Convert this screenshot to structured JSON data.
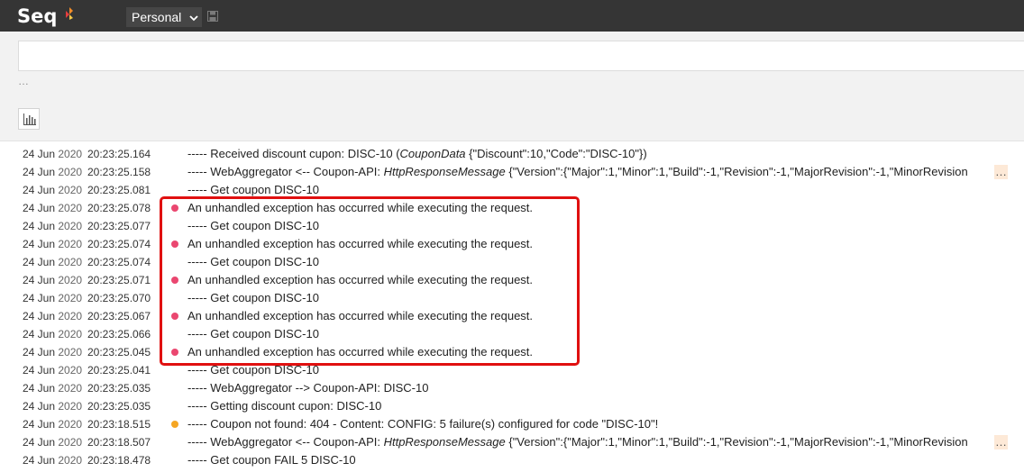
{
  "app": {
    "logo_text": "Seq",
    "workspace_label": "Personal"
  },
  "search": {
    "value": "",
    "placeholder": ""
  },
  "signal_hint": "…",
  "colors": {
    "error": "#ea4770",
    "warning": "#f5a623",
    "topbar": "#353535",
    "annotation": "#e01010"
  },
  "icons": {
    "workspace_dropdown": "chevron-down-icon",
    "save": "save-icon",
    "chart": "bar-chart-icon"
  },
  "events": [
    {
      "date": "24 Jun",
      "year": "2020",
      "time": "20:23:25.164",
      "level": "info",
      "prefix": "----- Received discount cupon: DISC-10 (",
      "type": "CouponData",
      "suffix": " {\"Discount\":10,\"Code\":\"DISC-10\"})",
      "truncated": false
    },
    {
      "date": "24 Jun",
      "year": "2020",
      "time": "20:23:25.158",
      "level": "info",
      "prefix": "----- WebAggregator <-- Coupon-API: ",
      "type": "HttpResponseMessage",
      "suffix": " {\"Version\":{\"Major\":1,\"Minor\":1,\"Build\":-1,\"Revision\":-1,\"MajorRevision\":-1,\"MinorRevision",
      "truncated": true
    },
    {
      "date": "24 Jun",
      "year": "2020",
      "time": "20:23:25.081",
      "level": "info",
      "prefix": "----- Get coupon DISC-10",
      "type": "",
      "suffix": "",
      "truncated": false
    },
    {
      "date": "24 Jun",
      "year": "2020",
      "time": "20:23:25.078",
      "level": "error",
      "prefix": "An unhandled exception has occurred while executing the request.",
      "type": "",
      "suffix": "",
      "truncated": false
    },
    {
      "date": "24 Jun",
      "year": "2020",
      "time": "20:23:25.077",
      "level": "info",
      "prefix": "----- Get coupon DISC-10",
      "type": "",
      "suffix": "",
      "truncated": false
    },
    {
      "date": "24 Jun",
      "year": "2020",
      "time": "20:23:25.074",
      "level": "error",
      "prefix": "An unhandled exception has occurred while executing the request.",
      "type": "",
      "suffix": "",
      "truncated": false
    },
    {
      "date": "24 Jun",
      "year": "2020",
      "time": "20:23:25.074",
      "level": "info",
      "prefix": "----- Get coupon DISC-10",
      "type": "",
      "suffix": "",
      "truncated": false
    },
    {
      "date": "24 Jun",
      "year": "2020",
      "time": "20:23:25.071",
      "level": "error",
      "prefix": "An unhandled exception has occurred while executing the request.",
      "type": "",
      "suffix": "",
      "truncated": false
    },
    {
      "date": "24 Jun",
      "year": "2020",
      "time": "20:23:25.070",
      "level": "info",
      "prefix": "----- Get coupon DISC-10",
      "type": "",
      "suffix": "",
      "truncated": false
    },
    {
      "date": "24 Jun",
      "year": "2020",
      "time": "20:23:25.067",
      "level": "error",
      "prefix": "An unhandled exception has occurred while executing the request.",
      "type": "",
      "suffix": "",
      "truncated": false
    },
    {
      "date": "24 Jun",
      "year": "2020",
      "time": "20:23:25.066",
      "level": "info",
      "prefix": "----- Get coupon DISC-10",
      "type": "",
      "suffix": "",
      "truncated": false
    },
    {
      "date": "24 Jun",
      "year": "2020",
      "time": "20:23:25.045",
      "level": "error",
      "prefix": "An unhandled exception has occurred while executing the request.",
      "type": "",
      "suffix": "",
      "truncated": false
    },
    {
      "date": "24 Jun",
      "year": "2020",
      "time": "20:23:25.041",
      "level": "info",
      "prefix": "----- Get coupon DISC-10",
      "type": "",
      "suffix": "",
      "truncated": false
    },
    {
      "date": "24 Jun",
      "year": "2020",
      "time": "20:23:25.035",
      "level": "info",
      "prefix": "----- WebAggregator --> Coupon-API: DISC-10",
      "type": "",
      "suffix": "",
      "truncated": false
    },
    {
      "date": "24 Jun",
      "year": "2020",
      "time": "20:23:25.035",
      "level": "info",
      "prefix": "----- Getting discount cupon: DISC-10",
      "type": "",
      "suffix": "",
      "truncated": false
    },
    {
      "date": "24 Jun",
      "year": "2020",
      "time": "20:23:18.515",
      "level": "warning",
      "prefix": "----- Coupon not found: 404 - Content: CONFIG: 5 failure(s) configured for code \"DISC-10\"!",
      "type": "",
      "suffix": "",
      "truncated": false
    },
    {
      "date": "24 Jun",
      "year": "2020",
      "time": "20:23:18.507",
      "level": "info",
      "prefix": "----- WebAggregator <-- Coupon-API: ",
      "type": "HttpResponseMessage",
      "suffix": " {\"Version\":{\"Major\":1,\"Minor\":1,\"Build\":-1,\"Revision\":-1,\"MajorRevision\":-1,\"MinorRevision",
      "truncated": true
    },
    {
      "date": "24 Jun",
      "year": "2020",
      "time": "20:23:18.478",
      "level": "info",
      "prefix": "----- Get coupon FAIL 5 DISC-10",
      "type": "",
      "suffix": "",
      "truncated": false
    }
  ]
}
